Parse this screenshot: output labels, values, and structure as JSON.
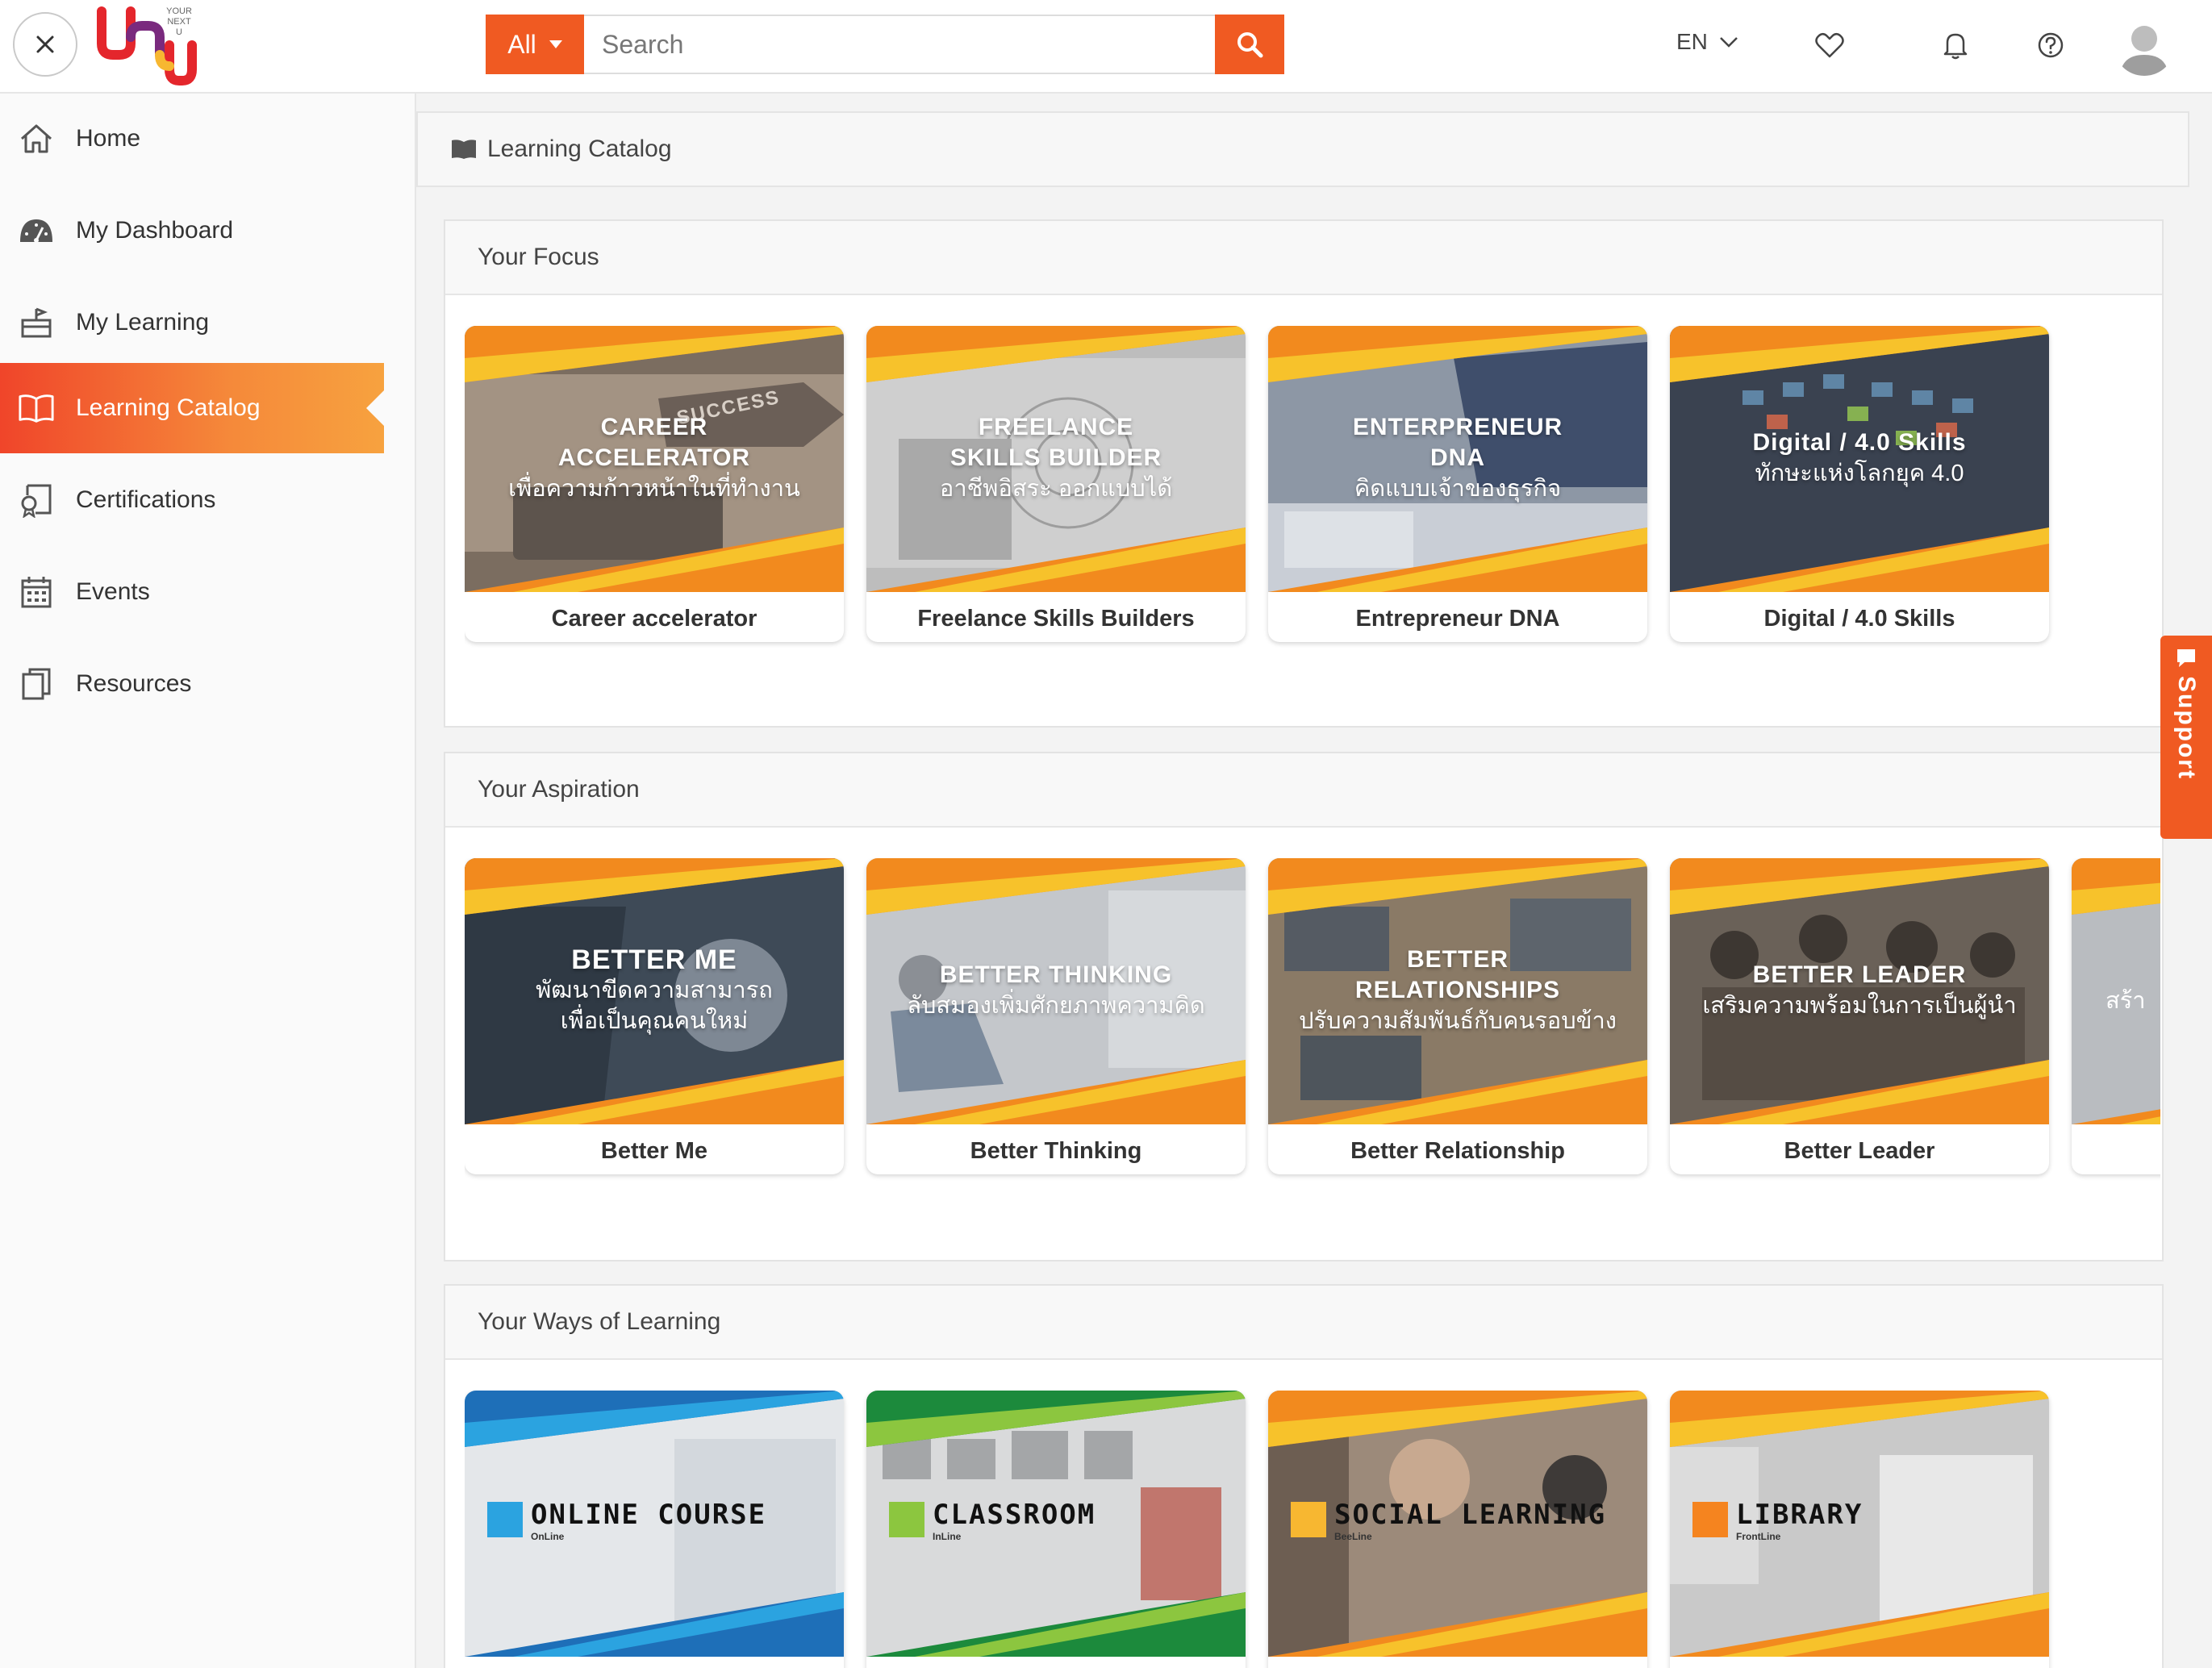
{
  "header": {
    "logo_text": "YOUR NEXT U",
    "search_category": "All",
    "search_placeholder": "Search",
    "language": "EN"
  },
  "sidebar": {
    "items": [
      {
        "label": "Home",
        "icon": "home-icon"
      },
      {
        "label": "My Dashboard",
        "icon": "dashboard-icon"
      },
      {
        "label": "My Learning",
        "icon": "learning-icon"
      },
      {
        "label": "Learning Catalog",
        "icon": "book-icon",
        "active": true
      },
      {
        "label": "Certifications",
        "icon": "certificate-icon"
      },
      {
        "label": "Events",
        "icon": "calendar-icon"
      },
      {
        "label": "Resources",
        "icon": "files-icon"
      }
    ]
  },
  "breadcrumb": {
    "label": "Learning Catalog",
    "icon": "book-open-icon"
  },
  "sections": [
    {
      "title": "Your Focus",
      "cards": [
        {
          "title1": "CAREER",
          "title2": "ACCELERATOR",
          "title3": "เพื่อความก้าวหน้าในที่ทำงาน",
          "label": "Career accelerator",
          "img_text": "SUCCESS"
        },
        {
          "title1": "FREELANCE",
          "title2": "SKILLS BUILDER",
          "title3": "อาชีพอิสระ ออกแบบได้",
          "label": "Freelance Skills Builders"
        },
        {
          "title1": "ENTERPRENEUR",
          "title2": "DNA",
          "title3": "คิดแบบเจ้าของธุรกิจ",
          "label": "Entrepreneur DNA"
        },
        {
          "title1": "Digital / 4.0 Skills",
          "title2": "ทักษะแห่งโลกยุค 4.0",
          "label": "Digital / 4.0 Skills"
        }
      ]
    },
    {
      "title": "Your Aspiration",
      "cards": [
        {
          "title1": "BETTER ME",
          "title2": "พัฒนาขีดความสามารถ",
          "title3": "เพื่อเป็นคุณคนใหม่",
          "label": "Better Me"
        },
        {
          "title1": "BETTER THINKING",
          "title2": "ลับสมองเพิ่มศักยภาพความคิด",
          "label": "Better Thinking"
        },
        {
          "title1": "BETTER",
          "title2": "RELATIONSHIPS",
          "title3": "ปรับความสัมพันธ์กับคนรอบข้าง",
          "label": "Better Relationship"
        },
        {
          "title1": "BETTER LEADER",
          "title2": "เสริมความพร้อมในการเป็นผู้นำ",
          "label": "Better Leader"
        },
        {
          "title1": "",
          "title2": "สร้า",
          "label": ""
        }
      ]
    },
    {
      "title": "Your Ways of Learning",
      "cards": [
        {
          "main": "ONLINE COURSE",
          "sub": "OnLine",
          "color": "#2ba3e0"
        },
        {
          "main": "CLASSROOM",
          "sub": "InLine",
          "color": "#8cc63f"
        },
        {
          "main": "SOCIAL LEARNING",
          "sub": "BeeLine",
          "color": "#f7b731"
        },
        {
          "main": "LIBRARY",
          "sub": "FrontLine",
          "color": "#f5841f"
        }
      ]
    }
  ],
  "support": {
    "label": "Support"
  },
  "colors": {
    "accent": "#f05a22",
    "stripe_orange": "#f28a1e",
    "stripe_yellow": "#f7c22b"
  }
}
